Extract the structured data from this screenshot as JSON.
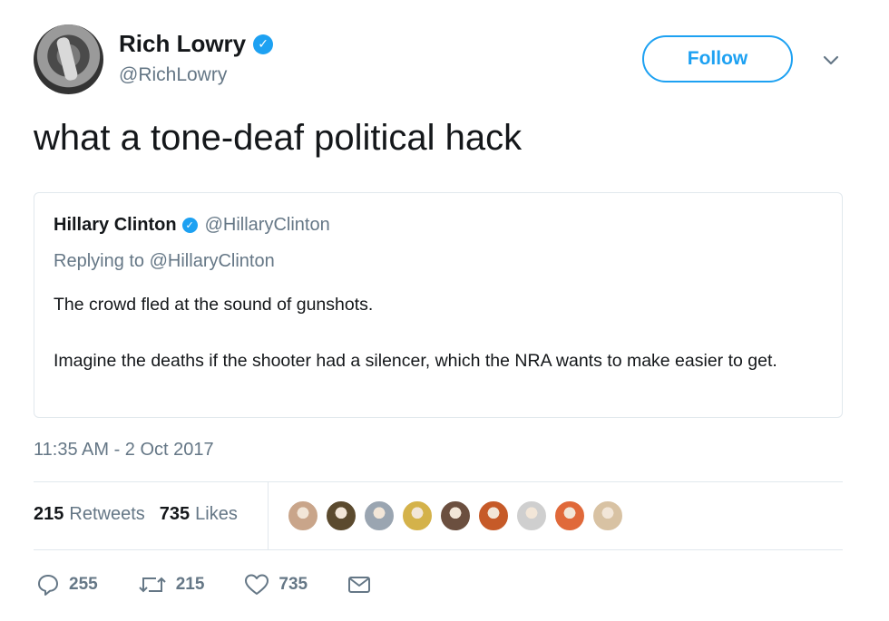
{
  "author": {
    "name": "Rich Lowry",
    "handle": "@RichLowry",
    "verified": true
  },
  "follow_label": "Follow",
  "tweet_text": "what a tone-deaf political hack",
  "quoted_tweet": {
    "name": "Hillary Clinton",
    "handle": "@HillaryClinton",
    "replying_to": "Replying to @HillaryClinton",
    "paragraphs": [
      "The crowd fled at the sound of gunshots.",
      "Imagine the deaths if the shooter had a silencer, which the NRA wants to make easier to get."
    ]
  },
  "timestamp": "11:35 AM - 2 Oct 2017",
  "stats": {
    "retweets_count": "215",
    "retweets_label": "Retweets",
    "likes_count": "735",
    "likes_label": "Likes"
  },
  "likers": [
    {
      "color": "#c9a58a"
    },
    {
      "color": "#5b4a2e"
    },
    {
      "color": "#9aa5b1"
    },
    {
      "color": "#d4b24a"
    },
    {
      "color": "#6b4f3f"
    },
    {
      "color": "#c65a28"
    },
    {
      "color": "#cfcfcf"
    },
    {
      "color": "#e0693a"
    },
    {
      "color": "#d8c2a3"
    }
  ],
  "actions": {
    "replies": "255",
    "retweets": "215",
    "likes": "735"
  },
  "colors": {
    "accent": "#1da1f2",
    "muted": "#657786",
    "border": "#e1e8ed"
  },
  "icons": [
    "verified-badge-icon",
    "chevron-down-icon",
    "reply-icon",
    "retweet-icon",
    "heart-icon",
    "message-icon"
  ]
}
